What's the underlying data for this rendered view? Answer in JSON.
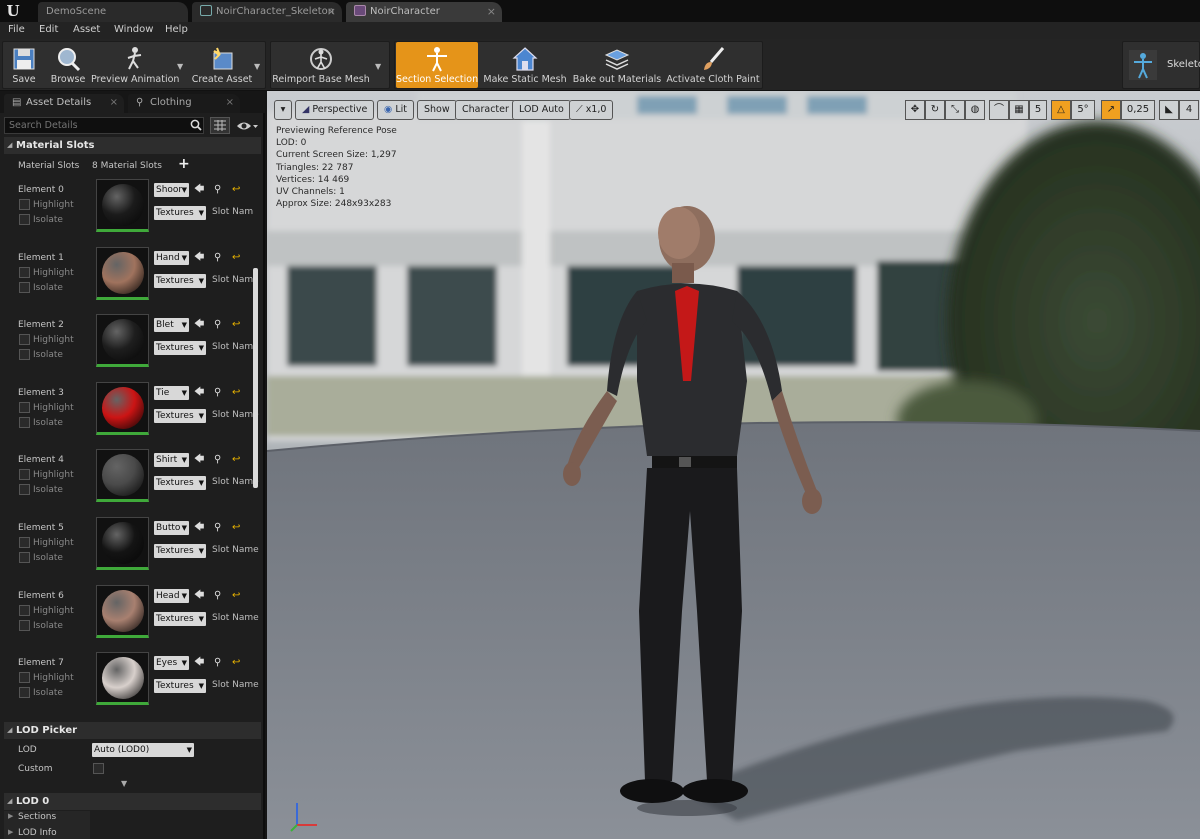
{
  "tabs": [
    {
      "label": "DemoScene"
    },
    {
      "label": "NoirCharacter_Skeleton"
    },
    {
      "label": "NoirCharacter"
    }
  ],
  "menu": [
    "File",
    "Edit",
    "Asset",
    "Window",
    "Help"
  ],
  "toolbar": {
    "save": "Save",
    "browse": "Browse",
    "preview_animation": "Preview Animation",
    "create_asset": "Create Asset",
    "reimport": "Reimport Base Mesh",
    "section_selection": "Section Selection",
    "make_static_mesh": "Make Static Mesh",
    "bake_out_materials": "Bake out Materials",
    "activate_cloth_paint": "Activate Cloth Paint",
    "skeleton": "Skeleto"
  },
  "left_panel": {
    "tabs": [
      "Asset Details",
      "Clothing"
    ],
    "search_placeholder": "Search Details",
    "material_slots_header": "Material Slots",
    "material_slots_label": "Material Slots",
    "material_slots_count": "8 Material Slots",
    "highlight": "Highlight",
    "isolate": "Isolate",
    "textures": "Textures",
    "elements": [
      {
        "label": "Element 0",
        "slot": "Shoor",
        "slot_name": "Slot Nam",
        "color": "#1b1b1b"
      },
      {
        "label": "Element 1",
        "slot": "Hand",
        "slot_name": "Slot Nam",
        "color": "#a0735e"
      },
      {
        "label": "Element 2",
        "slot": "Blet",
        "slot_name": "Slot Nam",
        "color": "#1e1e1e"
      },
      {
        "label": "Element 3",
        "slot": "Tie",
        "slot_name": "Slot Name",
        "color": "#cc1414"
      },
      {
        "label": "Element 4",
        "slot": "Shirt",
        "slot_name": "Slot Name",
        "color": "#4a4a4a"
      },
      {
        "label": "Element 5",
        "slot": "Butto",
        "slot_name": "Slot Name",
        "color": "#141414"
      },
      {
        "label": "Element 6",
        "slot": "Head",
        "slot_name": "Slot Name",
        "color": "#a88070"
      },
      {
        "label": "Element 7",
        "slot": "Eyes",
        "slot_name": "Slot Name",
        "color": "#d8d0cc"
      }
    ],
    "lod_picker_header": "LOD Picker",
    "lod_label": "LOD",
    "lod_value": "Auto (LOD0)",
    "custom_label": "Custom",
    "lod0_header": "LOD 0",
    "sections_label": "Sections",
    "lod_info_label": "LOD Info"
  },
  "viewport": {
    "perspective": "Perspective",
    "lit": "Lit",
    "show": "Show",
    "character": "Character",
    "lod_auto": "LOD Auto",
    "speed": "x1,0",
    "grid_snap": "5",
    "rot_snap": "5°",
    "scale_snap": "0,25",
    "cam_speed": "4",
    "stats": [
      "Previewing Reference Pose",
      "LOD: 0",
      "Current Screen Size: 1,297",
      "Triangles: 22 787",
      "Vertices: 14 469",
      "UV Channels: 1",
      "Approx Size: 248x93x283"
    ]
  }
}
